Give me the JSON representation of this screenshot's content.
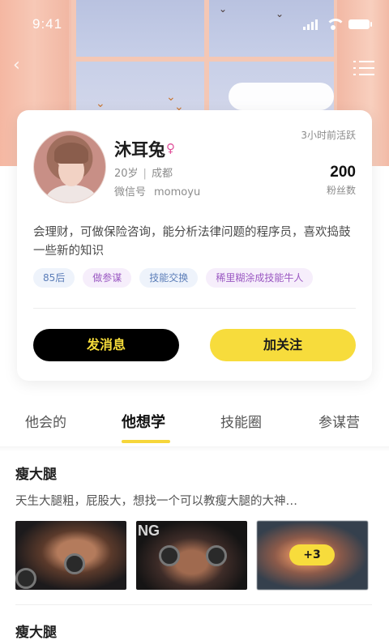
{
  "status_bar": {
    "time": "9:41"
  },
  "profile": {
    "name": "沐耳兔",
    "gender_symbol": "♀",
    "last_active": "3小时前活跃",
    "age": "20岁",
    "city": "成都",
    "wechat_label": "微信号",
    "wechat_id": "momoyu",
    "fans_count": "200",
    "fans_label": "粉丝数",
    "bio": "会理财，可做保险咨询，能分析法律问题的程序员，喜欢捣鼓一些新的知识",
    "tags": [
      {
        "label": "85后",
        "style": "blue"
      },
      {
        "label": "做参谋",
        "style": "purple"
      },
      {
        "label": "技能交换",
        "style": "blue"
      },
      {
        "label": "稀里糊涂成技能牛人",
        "style": "purple"
      }
    ],
    "message_button": "发消息",
    "follow_button": "加关注"
  },
  "tabs": [
    {
      "label": "他会的",
      "active": false
    },
    {
      "label": "他想学",
      "active": true
    },
    {
      "label": "技能圈",
      "active": false
    },
    {
      "label": "参谋营",
      "active": false
    }
  ],
  "items": [
    {
      "title": "瘦大腿",
      "description": "天生大腿粗，屁股大，想找一个可以教瘦大腿的大神…",
      "photo_brand_text": "NG",
      "more_count": "+3"
    },
    {
      "title": "瘦大腿"
    }
  ],
  "colors": {
    "accent_yellow": "#f7dc3c",
    "black_button": "#000000",
    "tag_blue_text": "#5b7db8",
    "tag_purple_text": "#9a58c2",
    "gender_pink": "#e0519a"
  },
  "icons": [
    "back-chevron-icon",
    "menu-list-icon",
    "signal-icon",
    "wifi-icon",
    "battery-icon",
    "female-icon"
  ]
}
